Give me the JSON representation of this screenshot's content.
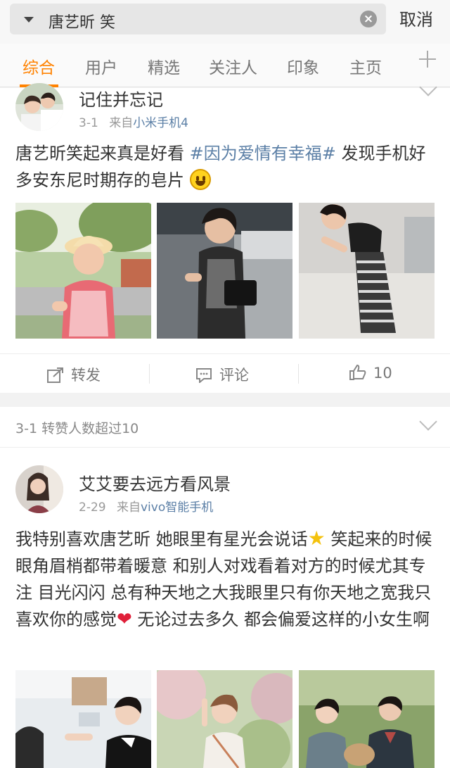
{
  "search": {
    "query": "唐艺昕 笑",
    "cancel_label": "取消"
  },
  "tabs": [
    {
      "label": "综合"
    },
    {
      "label": "用户"
    },
    {
      "label": "精选"
    },
    {
      "label": "关注人"
    },
    {
      "label": "印象"
    },
    {
      "label": "主页"
    }
  ],
  "accent_color": "#ff8200",
  "link_color": "#5b7fa6",
  "post1": {
    "username": "记住并忘记",
    "date": "3-1",
    "source_prefix": "来自",
    "source": "小米手机4",
    "text_before": "唐艺昕笑起来真是好看 ",
    "hashtag": "#因为爱情有幸福#",
    "text_after": " 发现手机好多安东尼时期存的皂片",
    "emoji": "grinning-face",
    "actions": {
      "repost": "转发",
      "comment": "评论",
      "like_count": "10"
    }
  },
  "post2": {
    "header": "3-1 转赞人数超过10",
    "username": "艾艾要去远方看风景",
    "date": "2-29",
    "source_prefix": "来自",
    "source": "vivo智能手机",
    "text_part1": "我特别喜欢唐艺昕 她眼里有星光会说话",
    "emoji1": "glowing-star",
    "text_part2": " 笑起来的时候眼角眉梢都带着暖意 和别人对戏看着对方的时候尤其专注 目光闪闪 总有种天地之大我眼里只有你天地之宽我只喜欢你的感觉",
    "emoji2": "red-heart",
    "text_part3": " 无论过去多久 都会偏爱这样的小女生啊"
  }
}
